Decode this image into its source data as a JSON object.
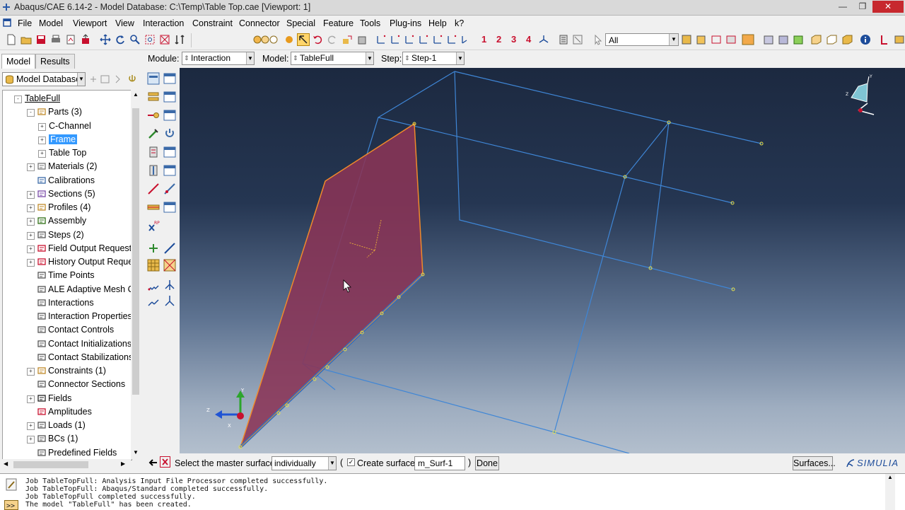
{
  "window": {
    "title": "Abaqus/CAE 6.14-2 - Model Database: C:\\Temp\\Table Top.cae [Viewport: 1]",
    "minimize": "—",
    "maximize": "❐",
    "close": "✕"
  },
  "menubar": [
    {
      "label": "File"
    },
    {
      "label": "Model"
    },
    {
      "label": "Viewport"
    },
    {
      "label": "View"
    },
    {
      "label": "Interaction"
    },
    {
      "label": "Constraint"
    },
    {
      "label": "Connector"
    },
    {
      "label": "Special"
    },
    {
      "label": "Feature"
    },
    {
      "label": "Tools"
    },
    {
      "label": "Plug-ins"
    },
    {
      "label": "Help"
    },
    {
      "label": "k?"
    }
  ],
  "toolbar": {
    "numbers": [
      "1",
      "2",
      "3",
      "4"
    ],
    "selection_filter": "All"
  },
  "context": {
    "module_label": "Module:",
    "module_value": "Interaction",
    "model_label": "Model:",
    "model_value": "TableFull",
    "step_label": "Step:",
    "step_value": "Step-1"
  },
  "left_panel": {
    "tabs": [
      {
        "label": "Model"
      },
      {
        "label": "Results"
      }
    ],
    "db_combo": "Model Database",
    "tree": [
      {
        "label": "TableFull",
        "level": 0,
        "exp": "-",
        "underline": true
      },
      {
        "label": "Parts (3)",
        "level": 1,
        "exp": "-",
        "icon": "parts"
      },
      {
        "label": "C-Channel",
        "level": 2,
        "exp": "+"
      },
      {
        "label": "Frame",
        "level": 2,
        "exp": "+",
        "selected": true
      },
      {
        "label": "Table Top",
        "level": 2,
        "exp": "+"
      },
      {
        "label": "Materials (2)",
        "level": 1,
        "exp": "+",
        "icon": "material"
      },
      {
        "label": "Calibrations",
        "level": 1,
        "exp": "",
        "icon": "calib"
      },
      {
        "label": "Sections (5)",
        "level": 1,
        "exp": "+",
        "icon": "section"
      },
      {
        "label": "Profiles (4)",
        "level": 1,
        "exp": "+",
        "icon": "profile"
      },
      {
        "label": "Assembly",
        "level": 1,
        "exp": "+",
        "icon": "assembly"
      },
      {
        "label": "Steps (2)",
        "level": 1,
        "exp": "+",
        "icon": "steps"
      },
      {
        "label": "Field Output Requests",
        "level": 1,
        "exp": "+",
        "icon": "field"
      },
      {
        "label": "History Output Requests",
        "level": 1,
        "exp": "+",
        "icon": "history"
      },
      {
        "label": "Time Points",
        "level": 1,
        "exp": "",
        "icon": "time"
      },
      {
        "label": "ALE Adaptive Mesh Constraints",
        "level": 1,
        "exp": "",
        "icon": "ale"
      },
      {
        "label": "Interactions",
        "level": 1,
        "exp": "",
        "icon": "interaction"
      },
      {
        "label": "Interaction Properties",
        "level": 1,
        "exp": "",
        "icon": "intprop"
      },
      {
        "label": "Contact Controls",
        "level": 1,
        "exp": "",
        "icon": "contact"
      },
      {
        "label": "Contact Initializations",
        "level": 1,
        "exp": "",
        "icon": "contact"
      },
      {
        "label": "Contact Stabilizations",
        "level": 1,
        "exp": "",
        "icon": "contact"
      },
      {
        "label": "Constraints (1)",
        "level": 1,
        "exp": "+",
        "icon": "constraint"
      },
      {
        "label": "Connector Sections",
        "level": 1,
        "exp": "",
        "icon": "connector"
      },
      {
        "label": "Fields",
        "level": 1,
        "exp": "+",
        "icon": "fields"
      },
      {
        "label": "Amplitudes",
        "level": 1,
        "exp": "",
        "icon": "amplitude"
      },
      {
        "label": "Loads (1)",
        "level": 1,
        "exp": "+",
        "icon": "load"
      },
      {
        "label": "BCs (1)",
        "level": 1,
        "exp": "+",
        "icon": "bc"
      },
      {
        "label": "Predefined Fields",
        "level": 1,
        "exp": "",
        "icon": "predef"
      }
    ]
  },
  "prompt": {
    "text": "Select the master surface",
    "method": "individually",
    "open_paren": "(",
    "create_surface_label": "Create surface:",
    "create_surface_checked": true,
    "surface_name": "m_Surf-1",
    "close_paren": ")",
    "done_label": "Done",
    "surfaces_button": "Surfaces...",
    "brand": "SIMULIA"
  },
  "messages": [
    "Job TableTopFull: Analysis Input File Processor completed successfully.",
    "Job TableTopFull: Abaqus/Standard completed successfully.",
    "Job TableTopFull completed successfully.",
    "The model \"TableFull\" has been created."
  ],
  "viewport": {
    "triad_labels": {
      "y": "Y",
      "z": "Z",
      "x": "X"
    },
    "colors": {
      "wire": "#3f86d6",
      "face": "#8a3456",
      "edge": "#f0892a",
      "node": "#e8e24b"
    }
  }
}
